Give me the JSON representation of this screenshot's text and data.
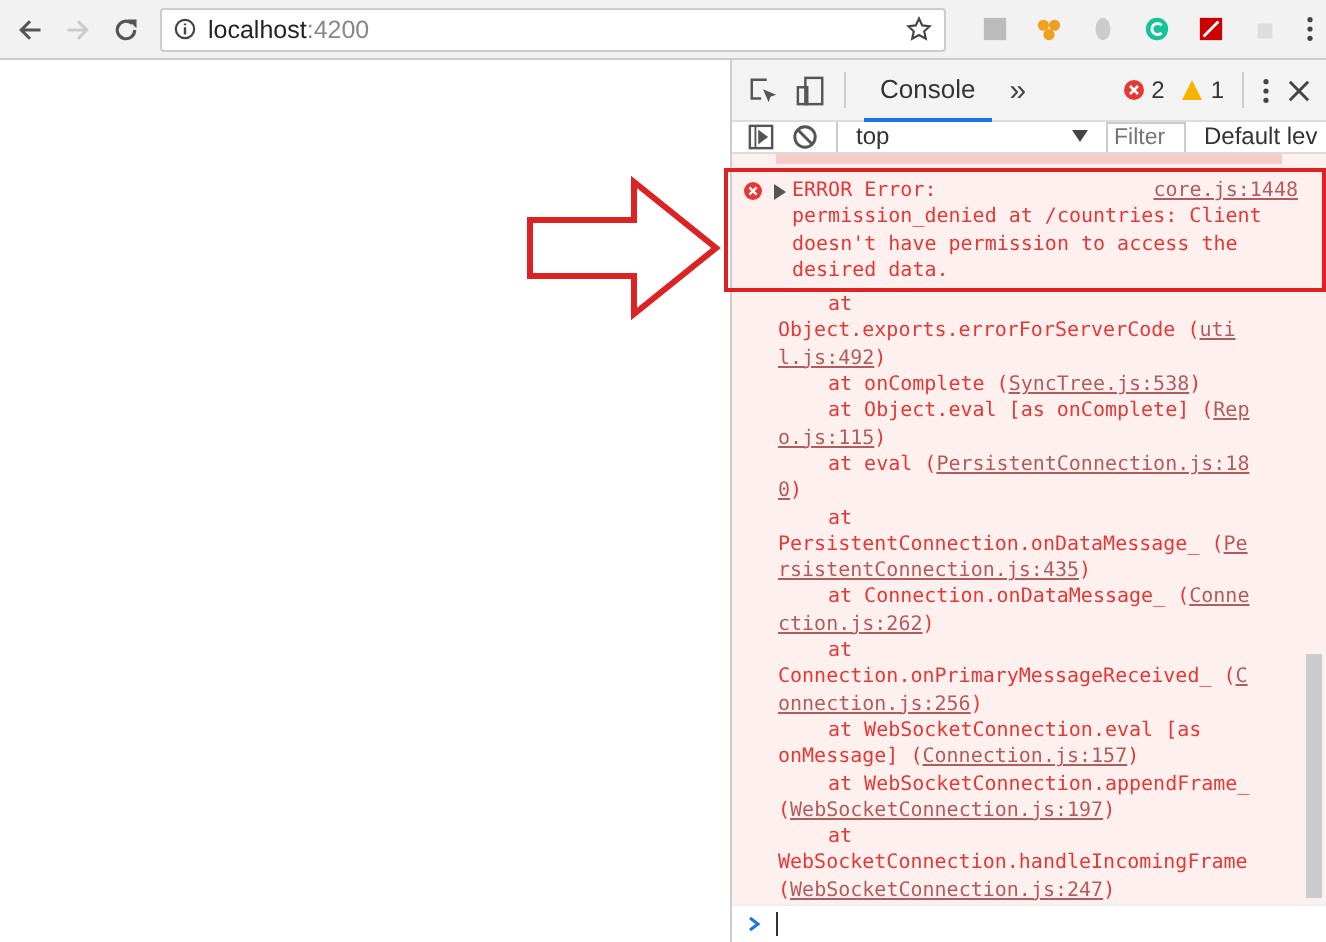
{
  "browser": {
    "back_enabled": true,
    "forward_enabled": false,
    "url_host": "localhost",
    "url_port": ":4200"
  },
  "devtools": {
    "tabs": [
      {
        "label": "Console",
        "selected": true
      }
    ],
    "more_tabs": "»",
    "error_count": "2",
    "warning_count": "1",
    "context": "top",
    "filter_placeholder": "Filter",
    "levels": "Default lev"
  },
  "console": {
    "error": {
      "title": "ERROR Error:",
      "lines": [
        "permission_denied at /countries: Client",
        "doesn't have permission to access the",
        "desired data."
      ],
      "source": "core.js:1448"
    },
    "trace": [
      {
        "kind": "indented",
        "segments": [
          {
            "kind": "text",
            "text": "at"
          }
        ]
      },
      {
        "kind": "plain",
        "segments": [
          {
            "kind": "text",
            "text": "Object.exports.errorForServerCode ("
          },
          {
            "kind": "link",
            "text": "uti"
          }
        ]
      },
      {
        "kind": "plain",
        "segments": [
          {
            "kind": "link",
            "text": "l.js:492"
          },
          {
            "kind": "text",
            "text": ")"
          }
        ]
      },
      {
        "kind": "indented",
        "segments": [
          {
            "kind": "text",
            "text": "at onComplete ("
          },
          {
            "kind": "link",
            "text": "SyncTree.js:538"
          },
          {
            "kind": "text",
            "text": ")"
          }
        ]
      },
      {
        "kind": "indented",
        "segments": [
          {
            "kind": "text",
            "text": "at Object.eval [as onComplete] ("
          },
          {
            "kind": "link",
            "text": "Rep"
          }
        ]
      },
      {
        "kind": "plain",
        "segments": [
          {
            "kind": "link",
            "text": "o.js:115"
          },
          {
            "kind": "text",
            "text": ")"
          }
        ]
      },
      {
        "kind": "indented",
        "segments": [
          {
            "kind": "text",
            "text": "at eval ("
          },
          {
            "kind": "link",
            "text": "PersistentConnection.js:18"
          }
        ]
      },
      {
        "kind": "plain",
        "segments": [
          {
            "kind": "link",
            "text": "0"
          },
          {
            "kind": "text",
            "text": ")"
          }
        ]
      },
      {
        "kind": "indented",
        "segments": [
          {
            "kind": "text",
            "text": "at"
          }
        ]
      },
      {
        "kind": "plain",
        "segments": [
          {
            "kind": "text",
            "text": "PersistentConnection.onDataMessage_ ("
          },
          {
            "kind": "link",
            "text": "Pe"
          }
        ]
      },
      {
        "kind": "plain",
        "segments": [
          {
            "kind": "link",
            "text": "rsistentConnection.js:435"
          },
          {
            "kind": "text",
            "text": ")"
          }
        ]
      },
      {
        "kind": "indented",
        "segments": [
          {
            "kind": "text",
            "text": "at Connection.onDataMessage_ ("
          },
          {
            "kind": "link",
            "text": "Conne"
          }
        ]
      },
      {
        "kind": "plain",
        "segments": [
          {
            "kind": "link",
            "text": "ction.js:262"
          },
          {
            "kind": "text",
            "text": ")"
          }
        ]
      },
      {
        "kind": "indented",
        "segments": [
          {
            "kind": "text",
            "text": "at"
          }
        ]
      },
      {
        "kind": "plain",
        "segments": [
          {
            "kind": "text",
            "text": "Connection.onPrimaryMessageReceived_ ("
          },
          {
            "kind": "link",
            "text": "C"
          }
        ]
      },
      {
        "kind": "plain",
        "segments": [
          {
            "kind": "link",
            "text": "onnection.js:256"
          },
          {
            "kind": "text",
            "text": ")"
          }
        ]
      },
      {
        "kind": "indented",
        "segments": [
          {
            "kind": "text",
            "text": "at WebSocketConnection.eval [as"
          }
        ]
      },
      {
        "kind": "plain",
        "segments": [
          {
            "kind": "text",
            "text": "onMessage] ("
          },
          {
            "kind": "link",
            "text": "Connection.js:157"
          },
          {
            "kind": "text",
            "text": ")"
          }
        ]
      },
      {
        "kind": "indented",
        "segments": [
          {
            "kind": "text",
            "text": "at WebSocketConnection.appendFrame_"
          }
        ]
      },
      {
        "kind": "plain",
        "segments": [
          {
            "kind": "text",
            "text": "("
          },
          {
            "kind": "link",
            "text": "WebSocketConnection.js:197"
          },
          {
            "kind": "text",
            "text": ")"
          }
        ]
      },
      {
        "kind": "indented",
        "segments": [
          {
            "kind": "text",
            "text": "at"
          }
        ]
      },
      {
        "kind": "plain",
        "segments": [
          {
            "kind": "text",
            "text": "WebSocketConnection.handleIncomingFrame"
          }
        ]
      },
      {
        "kind": "plain",
        "segments": [
          {
            "kind": "text",
            "text": "("
          },
          {
            "kind": "link",
            "text": "WebSocketConnection.js:247"
          },
          {
            "kind": "text",
            "text": ")"
          }
        ]
      }
    ]
  }
}
